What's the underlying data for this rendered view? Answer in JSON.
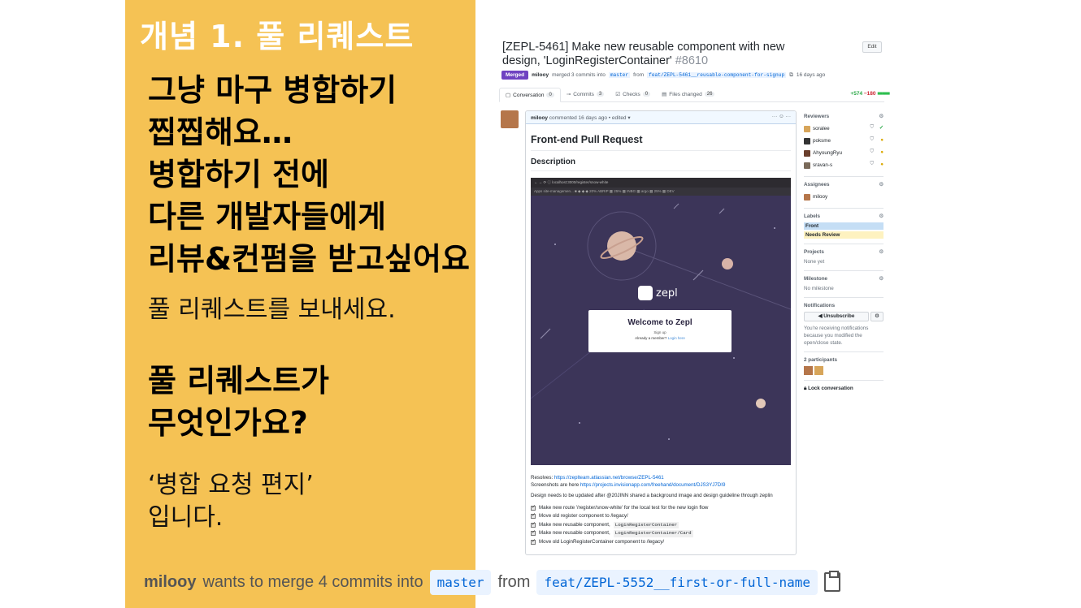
{
  "slide": {
    "title": "개념 1. 풀 리퀘스트",
    "bold_lines": [
      "그냥 마구 병합하기",
      "찝찝해요…",
      "병합하기 전에",
      "다른 개발자들에게",
      "리뷰&컨펌을 받고싶어요"
    ],
    "send_line": "풀 리퀘스트를 보내세요.",
    "question_lines": [
      "풀 리퀘스트가",
      "무엇인가요?"
    ],
    "answer_lines": [
      "‘병합 요청 편지’",
      "입니다."
    ]
  },
  "pr": {
    "title": "[ZEPL-5461] Make new reusable component with new design, 'LoginRegisterContainer'",
    "number": "#8610",
    "edit_label": "Edit",
    "merged_label": "Merged",
    "meta_user": "milooy",
    "meta_text": "merged 3 commits into",
    "meta_base": "master",
    "meta_from": "from",
    "meta_head": "feat/ZEPL-5461__reusable-component-for-signup",
    "meta_time": "16 days ago",
    "tabs": [
      {
        "label": "Conversation",
        "count": "0"
      },
      {
        "label": "Commits",
        "count": "3"
      },
      {
        "label": "Checks",
        "count": "0"
      },
      {
        "label": "Files changed",
        "count": "26"
      }
    ],
    "diff_add": "+574",
    "diff_del": "−180",
    "diff_blocks": "■■■■■",
    "comment_head_user": "milooy",
    "comment_head_text": "commented 16 days ago • edited ▾",
    "comment_head_dots": "··· ☺ ···",
    "heading": "Front-end Pull Request",
    "desc_heading": "Description",
    "shot_url": "localhost:3000/register/snow-white",
    "shot_bookmarks": "Apps   site-managemen...   ■  ◆  ◆  ◆   20% ABRIP   ▦ 25%   ▦ INBG   ▦ argo   ▦ 25%   ▦ DEV",
    "zepl_logo": "zepl",
    "welcome_title": "Welcome to Zepl",
    "welcome_signup": "Sign up",
    "welcome_member": "Already a member?",
    "welcome_login": "Login here",
    "resolves_label": "Resolves:",
    "resolves_link": "https://zeplteam.atlassian.net/browse/ZEPL-5461",
    "screenshots_label": "Screenshots are here",
    "screenshots_link": "https://projects.invisionapp.com/freehand/document/DJS3YJ7DI9",
    "design_note": "Design needs to be updated after @20JINN shared a background image and design guideline through zeplin",
    "tasks": [
      {
        "text": "Make new route '/register/snow-white' for the local test for the new login flow",
        "code": ""
      },
      {
        "text": "Move old register component to /legacy/",
        "code": ""
      },
      {
        "text": "Make new reusable component,",
        "code": "LoginRegisterContainer"
      },
      {
        "text": "Make new reusable component,",
        "code": "LoginRegisterContainer/Card"
      },
      {
        "text": "Move old LoginRegisterContainer component to /legacy/",
        "code": ""
      }
    ]
  },
  "sidebar": {
    "reviewers_label": "Reviewers",
    "reviewers": [
      {
        "name": "soralee",
        "status": "✓",
        "color": "#d7a55a"
      },
      {
        "name": "poksme",
        "status": "●",
        "color": "#333333"
      },
      {
        "name": "AhyoungRyu",
        "status": "●",
        "color": "#6a3e2c"
      },
      {
        "name": "sravan-s",
        "status": "●",
        "color": "#7a6a5a"
      }
    ],
    "assignees_label": "Assignees",
    "assignee": "milooy",
    "labels_label": "Labels",
    "label_front": "Front",
    "label_review": "Needs Review",
    "projects_label": "Projects",
    "projects_value": "None yet",
    "milestone_label": "Milestone",
    "milestone_value": "No milestone",
    "notifications_label": "Notifications",
    "unsubscribe_label": "◀ Unsubscribe",
    "notif_note": "You're receiving notifications because you modified the open/close state.",
    "participants_label": "2 participants",
    "lock_label": "Lock conversation"
  },
  "bottom": {
    "user": "milooy",
    "text": "wants to merge 4 commits into",
    "base": "master",
    "from": "from",
    "head": "feat/ZEPL-5552__first-or-full-name"
  },
  "colors": {
    "slide_bg": "#f5c254",
    "merged": "#6f42c1",
    "link": "#0366d6",
    "zepl_bg": "#3c3559"
  }
}
